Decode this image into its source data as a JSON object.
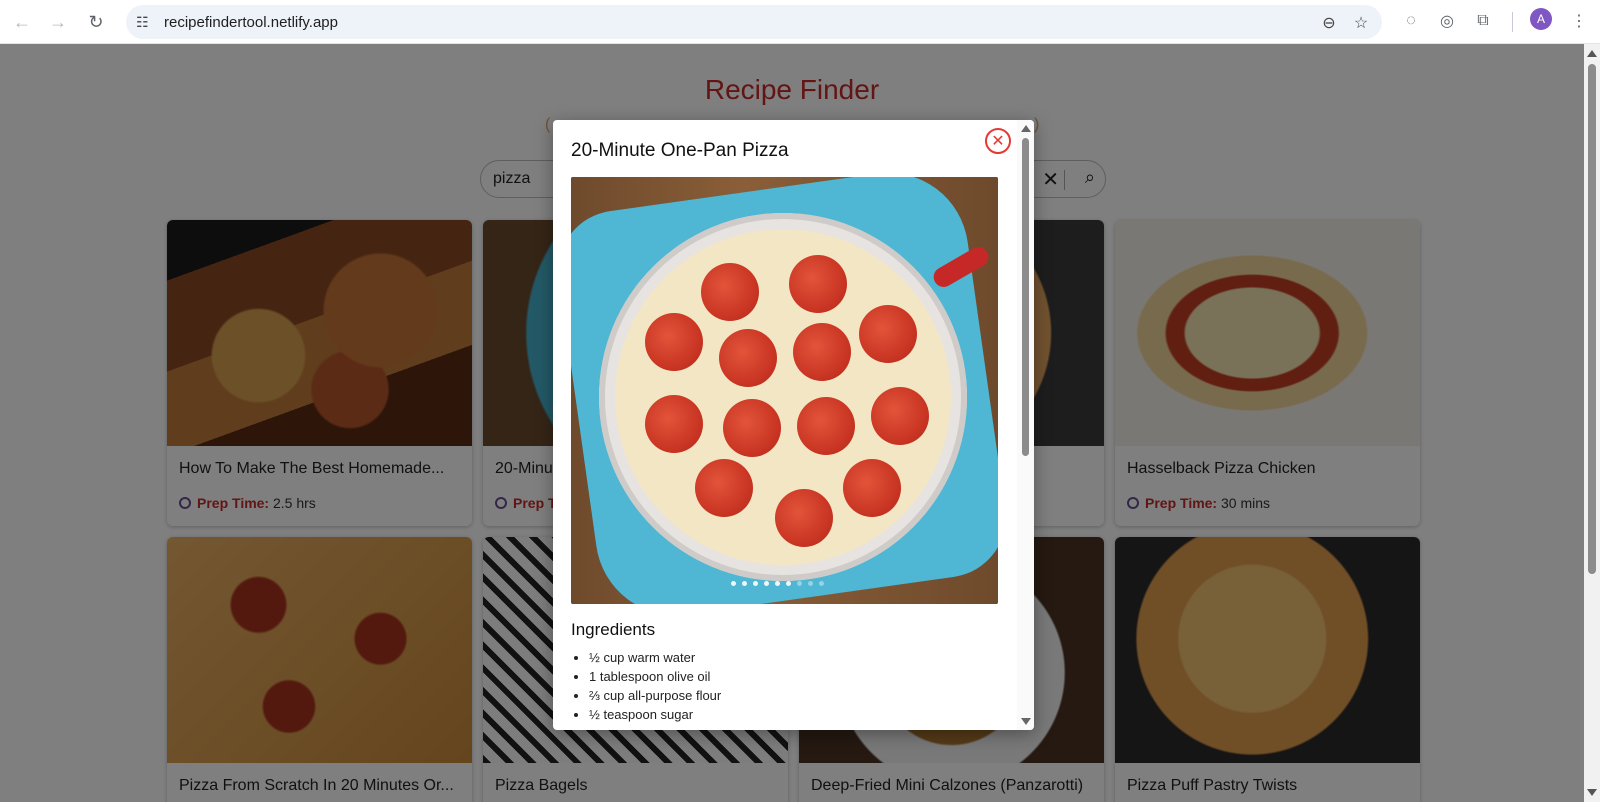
{
  "browser": {
    "url": "recipefindertool.netlify.app",
    "avatar_letter": "A"
  },
  "page": {
    "title": "Recipe Finder",
    "subtitle": "(",
    "subtitle_end": ")",
    "search_value": "pizza"
  },
  "cards": [
    {
      "name": "How To Make The Best Homemade...",
      "prep_label": "Prep Time:",
      "prep_value": "2.5 hrs"
    },
    {
      "name": "20-Minu",
      "prep_label": "Prep T",
      "prep_value": ""
    },
    {
      "name": "",
      "prep_label": "",
      "prep_value": ""
    },
    {
      "name": "Hasselback Pizza Chicken",
      "prep_label": "Prep Time:",
      "prep_value": "30 mins"
    },
    {
      "name": "Pizza From Scratch In 20 Minutes Or...",
      "prep_label": "",
      "prep_value": ""
    },
    {
      "name": "Pizza Bagels",
      "prep_label": "",
      "prep_value": ""
    },
    {
      "name": "Deep-Fried Mini Calzones (Panzarotti)",
      "prep_label": "",
      "prep_value": ""
    },
    {
      "name": "Pizza Puff Pastry Twists",
      "prep_label": "",
      "prep_value": ""
    }
  ],
  "modal": {
    "title": "20-Minute One-Pan Pizza",
    "ingredients_heading": "Ingredients",
    "ingredients": [
      "½ cup warm water",
      "1 tablespoon olive oil",
      "⅔ cup all-purpose flour",
      "½ teaspoon sugar"
    ],
    "close_symbol": "✕"
  },
  "colors": {
    "title_red": "#c62828",
    "accent_blue": "#4fb6d3",
    "avatar": "#7e57c2"
  }
}
